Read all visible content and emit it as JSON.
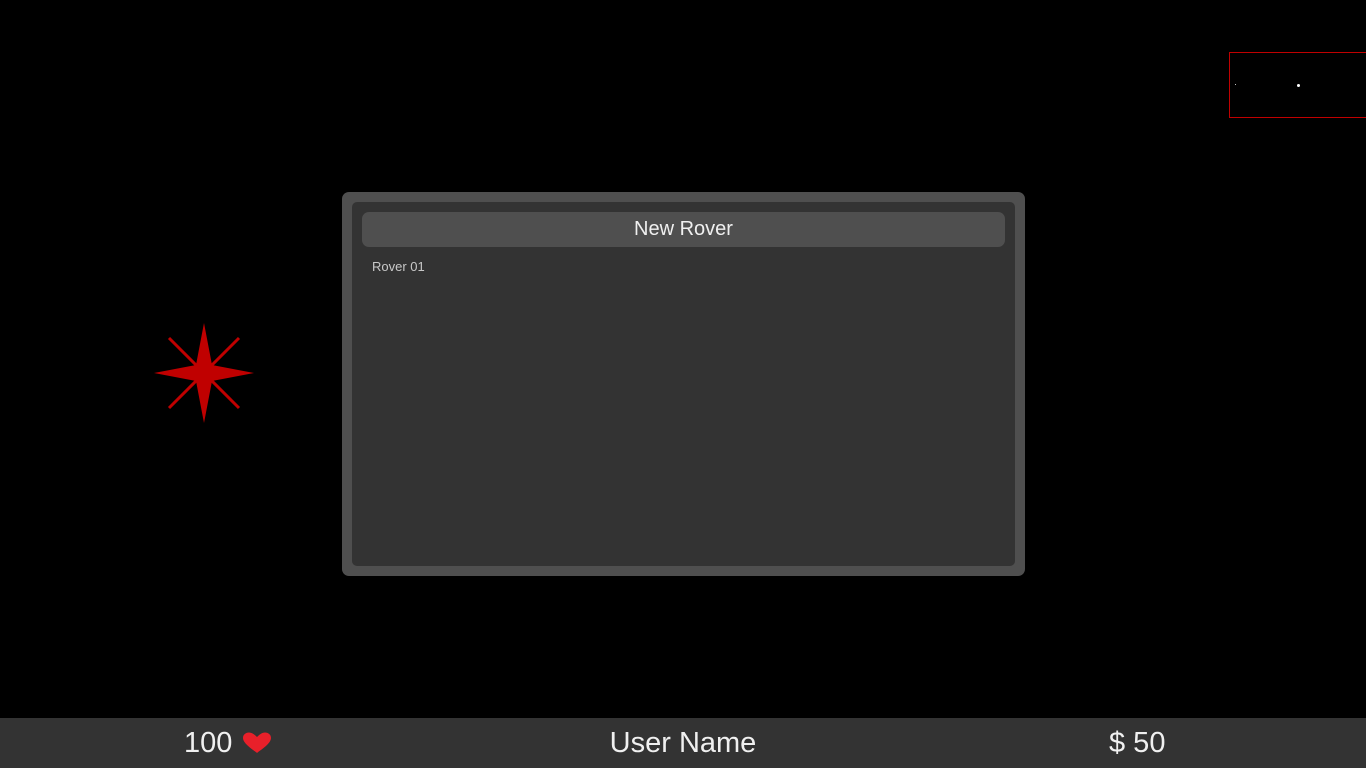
{
  "dialog": {
    "new_rover_label": "New Rover",
    "rovers": [
      "Rover 01"
    ]
  },
  "status_bar": {
    "health": "100",
    "user_name": "User Name",
    "money": "$ 50"
  },
  "icons": {
    "star": "red-compass-star-icon",
    "heart": "heart-icon"
  },
  "colors": {
    "accent_red": "#c00000",
    "heart_red": "#e8202a",
    "panel_bg": "#333333",
    "panel_border": "#4f4f4f"
  }
}
